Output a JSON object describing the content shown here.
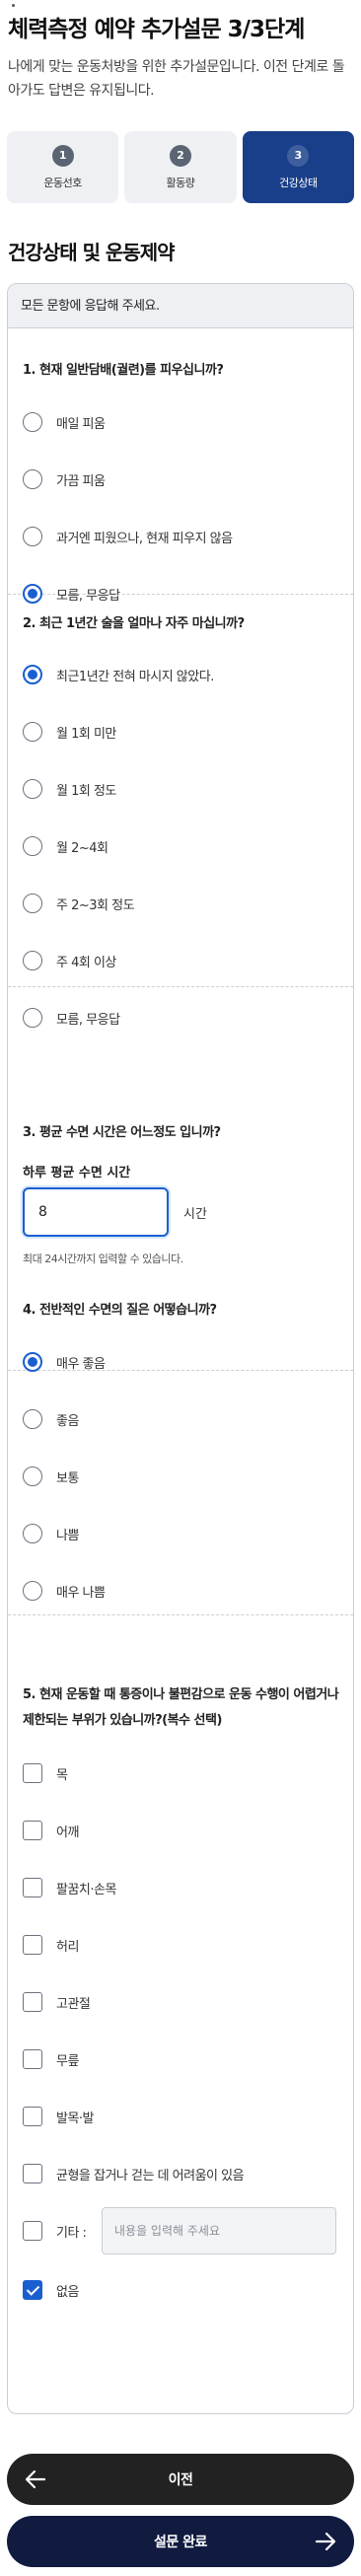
{
  "page": {
    "title": "체력측정 예약 추가설문 3/3단계",
    "intro": "나에게 맞는 운동처방을 위한 추가설문입니다. 이전 단계로 돌아가도 답변은 유지됩니다."
  },
  "steps": [
    {
      "num": "1",
      "label": "운동선호",
      "active": false
    },
    {
      "num": "2",
      "label": "활동량",
      "active": false
    },
    {
      "num": "3",
      "label": "건강상태",
      "active": true
    }
  ],
  "section_title": "건강상태 및 운동제약",
  "notice": "모든 문항에 응답해 주세요.",
  "q1": {
    "title": "1. 현재 일반담배(궐련)를 피우십니까?",
    "options": [
      "매일 피움",
      "가끔 피움",
      "과거엔 피웠으나, 현재 피우지 않음",
      "모름, 무응답"
    ],
    "selected": 3
  },
  "q2": {
    "title": "2. 최근 1년간 술을 얼마나 자주 마십니까?",
    "options": [
      "최근1년간 전혀 마시지 않았다.",
      "월 1회 미만",
      "월 1회 정도",
      "월 2~4회",
      "주 2~3회 정도",
      "주 4회 이상",
      "모름, 무응답"
    ],
    "selected": 0
  },
  "q3": {
    "title": "3. 평균 수면 시간은 어느정도 입니까?",
    "input_label": "하루 평균 수면 시간",
    "value": "8",
    "unit": "시간",
    "hint": "최대 24시간까지 입력할 수 있습니다."
  },
  "q4": {
    "title": "4. 전반적인 수면의 질은 어떻습니까?",
    "options": [
      "매우 좋음",
      "좋음",
      "보통",
      "나쁨",
      "매우 나쁨"
    ],
    "selected": 0
  },
  "q5": {
    "title": "5. 현재 운동할 때 통증이나 불편감으로 운동 수행이 어렵거나 제한되는 부위가 있습니까?(복수 선택)",
    "options": [
      "목",
      "어깨",
      "팔꿈치·손목",
      "허리",
      "고관절",
      "무릎",
      "발목·발",
      "균형을 잡거나 걷는 데 어려움이 있음"
    ],
    "other_label": "기타 :",
    "other_placeholder": "내용을 입력해 주세요",
    "none_label": "없음",
    "none_checked": true
  },
  "buttons": {
    "prev": "이전",
    "done": "설문 완료"
  },
  "colors": {
    "accent": "#1a5fd0",
    "step_active": "#1a3f8a",
    "button_dark": "#222222",
    "button_done": "#111a3f"
  },
  "icons": {
    "prev": "arrow-left-icon",
    "done": "arrow-right-icon"
  }
}
